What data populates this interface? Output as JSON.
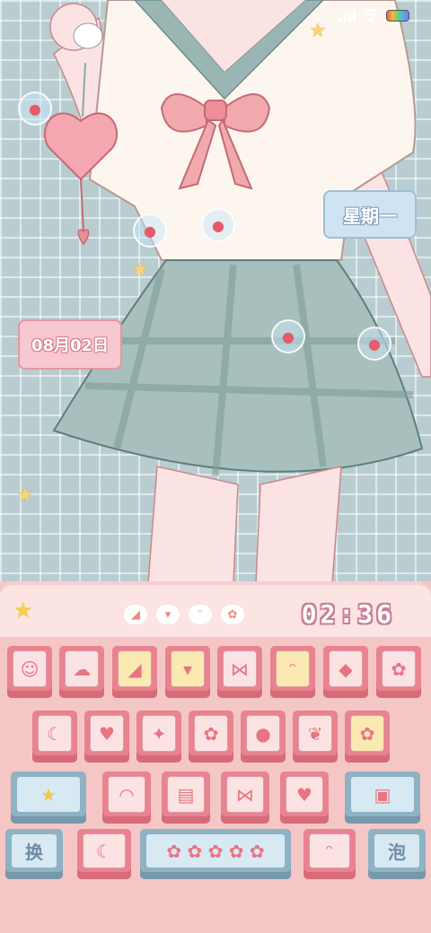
{
  "wallpaper": {
    "date_text": "08月02日",
    "weekday_text": "星期一"
  },
  "status_bar": {
    "signal_icon": "signal-icon",
    "wifi_icon": "wifi-icon",
    "battery_icon": "battery-icon"
  },
  "keyboard_toolbar": {
    "clock": "02:36",
    "quick_icons": [
      "watermelon-icon",
      "carrot-icon",
      "bunny-icon",
      "flower-icon"
    ],
    "comet_icon": "comet-icon"
  },
  "keys": {
    "row1": [
      "sun-face-icon",
      "cloud-icon",
      "watermelon-icon",
      "carrot-icon",
      "ribbon-icon",
      "bunny-icon",
      "candy-icon",
      "flower-icon"
    ],
    "row2": [
      "moon-icon",
      "heart-icon",
      "sparkle-icon",
      "flower-icon",
      "strawberry-icon",
      "peach-icon",
      "flower-icon"
    ],
    "row3": [
      "comet-icon",
      "rainbow-icon",
      "cake-icon",
      "ribbon-icon",
      "winged-heart-icon",
      "camera-icon"
    ],
    "row4": {
      "switch_label": "换",
      "bunny_moon_icon": "bunny-moon-icon",
      "space_icon": "flower-row-icon",
      "bunny_icon": "bunny-icon",
      "enter_label": "泡"
    }
  },
  "colors": {
    "grid_bg": "#b9cdd0",
    "keyboard_bg": "#f4c7c6",
    "key_pink": "#e8838f",
    "key_blue": "#8fb2c4"
  }
}
